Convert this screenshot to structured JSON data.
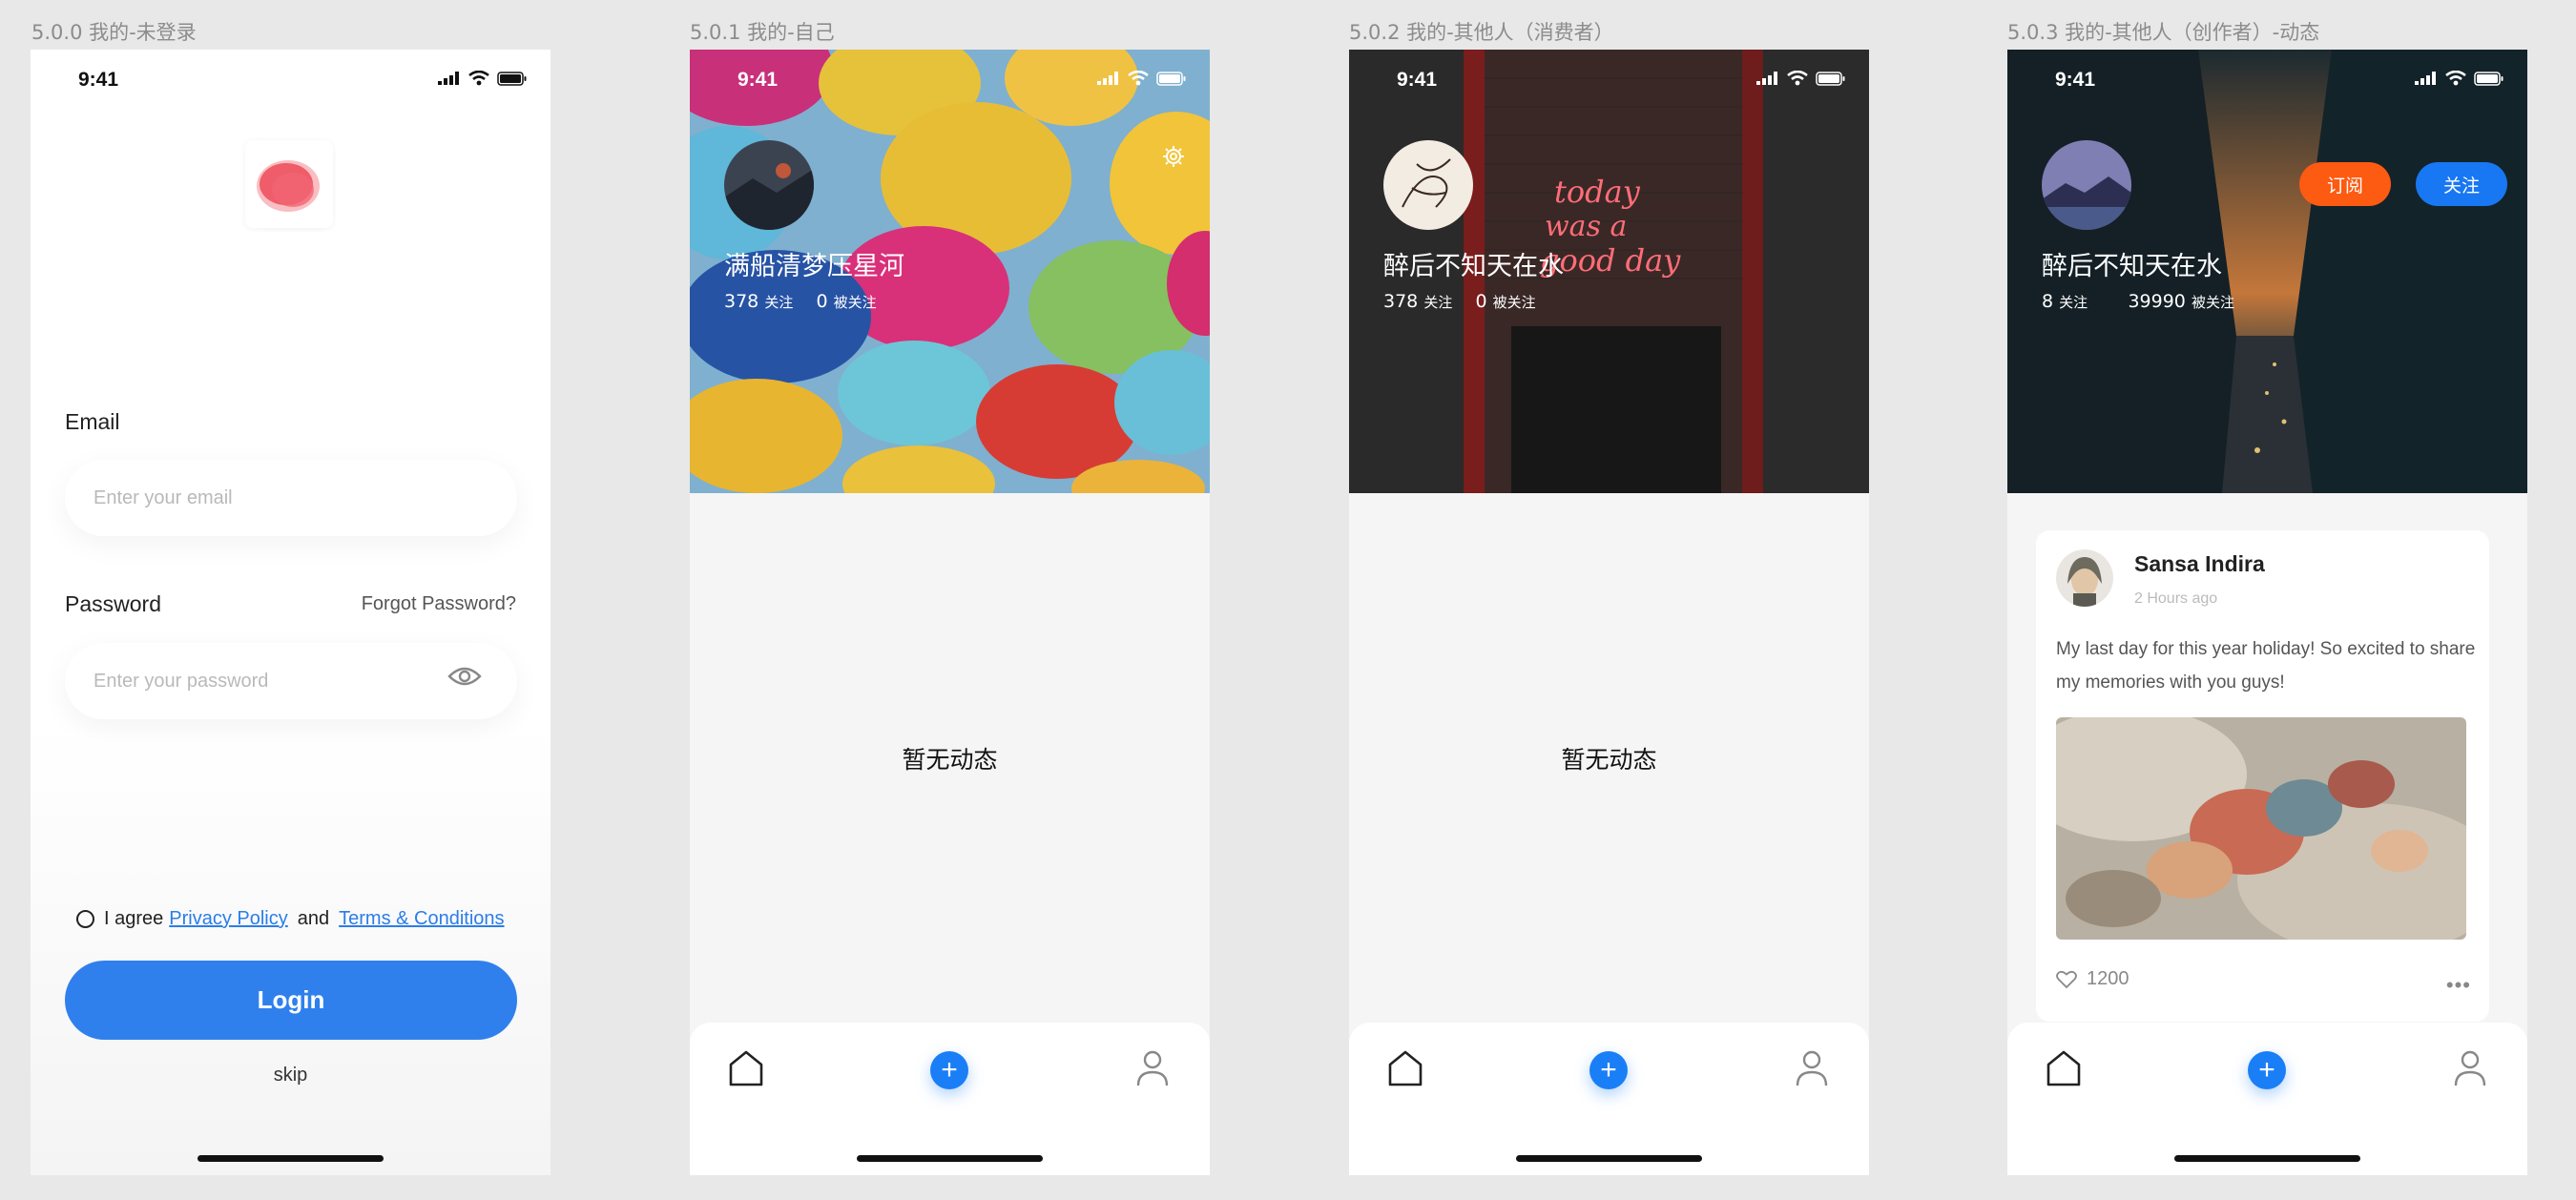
{
  "screens": [
    {
      "title": "5.0.0 我的-未登录"
    },
    {
      "title": "5.0.1 我的-自己"
    },
    {
      "title": "5.0.2 我的-其他人（消费者）"
    },
    {
      "title": "5.0.3 我的-其他人（创作者）-动态"
    }
  ],
  "status_time": "9:41",
  "login": {
    "email_label": "Email",
    "email_placeholder": "Enter your email",
    "password_label": "Password",
    "forgot_label": "Forgot Password?",
    "password_placeholder": "Enter your password",
    "agree_prefix": "I agree",
    "privacy_link": "Privacy Policy",
    "and_text": "and",
    "terms_link": "Terms & Conditions",
    "login_button": "Login",
    "skip_label": "skip"
  },
  "self_profile": {
    "username": "满船清梦压星河",
    "following_count": "378",
    "following_label": "关注",
    "followers_count": "0",
    "followers_label": "被关注",
    "empty_text": "暂无动态"
  },
  "consumer_profile": {
    "username": "醉后不知天在水",
    "following_count": "378",
    "following_label": "关注",
    "followers_count": "0",
    "followers_label": "被关注",
    "empty_text": "暂无动态"
  },
  "creator_profile": {
    "username": "醉后不知天在水",
    "following_count": "8",
    "following_label": "关注",
    "followers_count": "39990",
    "followers_label": "被关注",
    "subscribe_button": "订阅",
    "follow_button": "关注",
    "post": {
      "author": "Sansa Indira",
      "time": "2 Hours ago",
      "text": "My last day for this year holiday! So excited to share my memories with you guys!",
      "likes": "1200"
    }
  },
  "neon_sign": "today was a good day",
  "icons": [
    "signal-icon",
    "wifi-icon",
    "battery-icon",
    "eye-icon",
    "gear-icon",
    "home-icon",
    "add-icon",
    "user-icon",
    "heart-icon",
    "more-icon"
  ],
  "colors": {
    "primary": "#2f80ed",
    "subscribe": "#fd5a12",
    "follow": "#1877f2",
    "add": "#1a7ff7"
  }
}
